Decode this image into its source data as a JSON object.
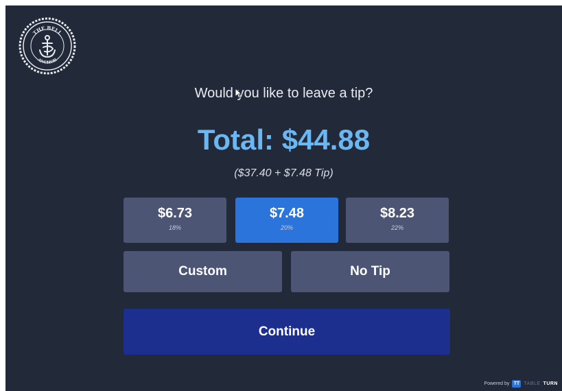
{
  "logo": {
    "top_text": "THE BELL",
    "bottom_text": "ANCHOR"
  },
  "prompt": {
    "question": "Would you like to leave a tip?",
    "total": "Total: $44.88",
    "breakdown": "($37.40 + $7.48 Tip)"
  },
  "tip_options": [
    {
      "amount": "$6.73",
      "percent": "18%",
      "selected": false
    },
    {
      "amount": "$7.48",
      "percent": "20%",
      "selected": true
    },
    {
      "amount": "$8.23",
      "percent": "22%",
      "selected": false
    }
  ],
  "actions": {
    "custom_label": "Custom",
    "no_tip_label": "No Tip",
    "continue_label": "Continue"
  },
  "footer": {
    "powered_by": "Powered by",
    "brand_mark": "TT",
    "brand_light": "TABLE",
    "brand_bold": "TURN"
  },
  "colors": {
    "background": "#222938",
    "total_text": "#6ab7f3",
    "button": "#4d5575",
    "selected_button": "#2a74db",
    "continue_button": "#1c2f8f"
  }
}
